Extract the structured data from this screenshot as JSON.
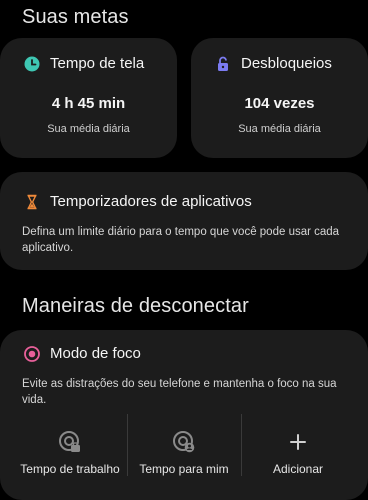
{
  "goals": {
    "title": "Suas metas",
    "screen_time": {
      "label": "Tempo de tela",
      "value": "4 h 45 min",
      "sub": "Sua média diária",
      "icon": "clock-icon",
      "accent": "#3ec7b3"
    },
    "unlocks": {
      "label": "Desbloqueios",
      "value": "104 vezes",
      "sub": "Sua média diária",
      "icon": "unlock-icon",
      "accent": "#7b7bf0"
    },
    "timers": {
      "label": "Temporizadores de aplicativos",
      "desc": "Defina um limite diário para o tempo que você pode usar cada aplicativo.",
      "icon": "hourglass-icon",
      "accent": "#f08a3a"
    }
  },
  "disconnect": {
    "title": "Maneiras de desconectar",
    "focus": {
      "label": "Modo de foco",
      "desc": "Evite as distrações do seu telefone e mantenha o foco na sua vida.",
      "icon": "focus-target-icon",
      "accent": "#e8609a",
      "modes": [
        {
          "label": "Tempo de trabalho",
          "icon": "work-focus-icon"
        },
        {
          "label": "Tempo para mim",
          "icon": "me-time-focus-icon"
        },
        {
          "label": "Adicionar",
          "icon": "plus-icon"
        }
      ]
    }
  }
}
